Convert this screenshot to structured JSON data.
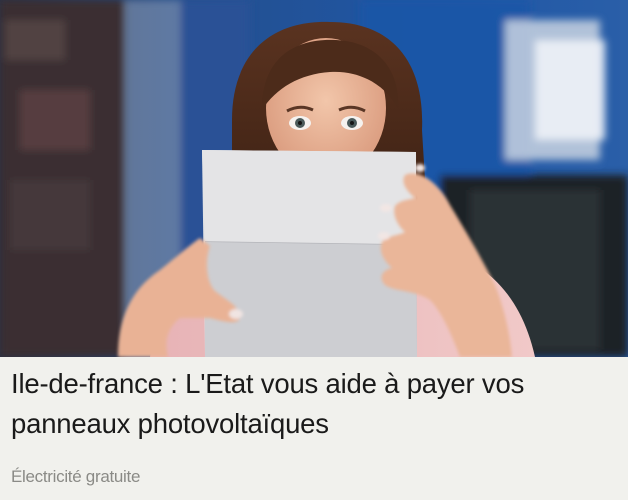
{
  "ad": {
    "image": {
      "alt": "Femme surprise lisant une facture"
    },
    "headline": "Ile-de-france : L'Etat vous aide à payer vos panneaux photovoltaïques",
    "sponsor": "Électricité gratuite"
  },
  "colors": {
    "background": "#f1f1ed",
    "headline": "#1a1a1a",
    "sponsor": "#8a8a86"
  }
}
